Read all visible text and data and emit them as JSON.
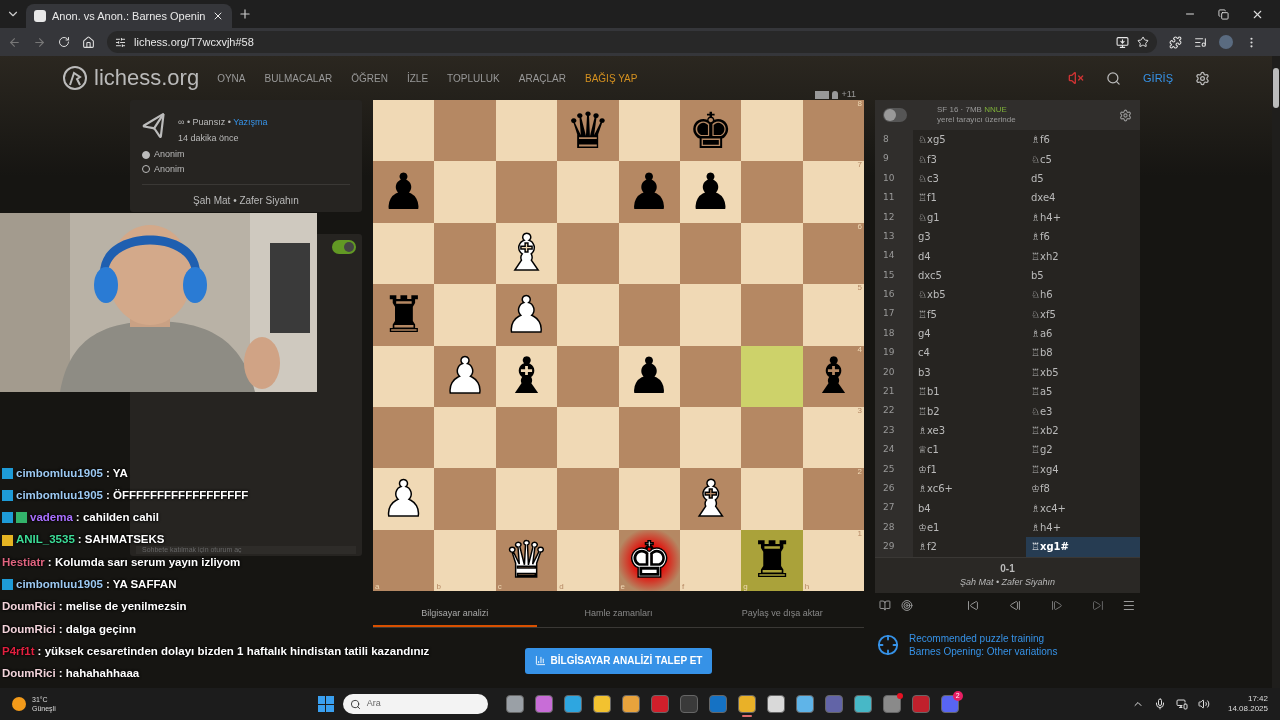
{
  "browser": {
    "tab_title": "Anon. vs Anon.: Barnes Openin",
    "url": "lichess.org/T7wcxvjh#58"
  },
  "site": {
    "logo": "lichess.org",
    "nav": [
      {
        "label": "OYNA",
        "kind": "plain"
      },
      {
        "label": "BULMACALAR",
        "kind": "plain"
      },
      {
        "label": "ÖĞREN",
        "kind": "plain"
      },
      {
        "label": "İZLE",
        "kind": "plain"
      },
      {
        "label": "TOPLULUK",
        "kind": "plain"
      },
      {
        "label": "ARAÇLAR",
        "kind": "plain"
      },
      {
        "label": "BAĞIŞ YAP",
        "kind": "donate"
      }
    ],
    "muted": true,
    "login": "GİRİŞ"
  },
  "game_info": {
    "speed": "∞",
    "separator": "•",
    "rated": "Puansız",
    "type": "Yazışma",
    "time_ago": "14 dakika önce",
    "players": [
      {
        "name": "Anonim",
        "white": true
      },
      {
        "name": "Anonim",
        "white": false
      }
    ],
    "status": "Şah Mat • Zafer Siyahın"
  },
  "chat_panel": {
    "enabled": true,
    "placeholder": "Sohbete katılmak için oturum aç"
  },
  "material": {
    "diff": "+11"
  },
  "board": {
    "files": [
      "a",
      "b",
      "c",
      "d",
      "e",
      "f",
      "g",
      "h"
    ],
    "rows": [
      {
        "rank": "8",
        "cells": [
          {
            "highlight": false
          },
          {
            "highlight": false
          },
          {
            "highlight": false
          },
          {
            "highlight": false,
            "piece": {
              "glyph": "♛",
              "white": false,
              "in_check": false
            }
          },
          {
            "highlight": false
          },
          {
            "highlight": false,
            "piece": {
              "glyph": "♚",
              "white": false,
              "in_check": false
            }
          },
          {
            "highlight": false
          },
          {
            "highlight": false
          }
        ]
      },
      {
        "rank": "7",
        "cells": [
          {
            "highlight": false,
            "piece": {
              "glyph": "♟",
              "white": false,
              "in_check": false
            }
          },
          {
            "highlight": false
          },
          {
            "highlight": false
          },
          {
            "highlight": false
          },
          {
            "highlight": false,
            "piece": {
              "glyph": "♟",
              "white": false,
              "in_check": false
            }
          },
          {
            "highlight": false,
            "piece": {
              "glyph": "♟",
              "white": false,
              "in_check": false
            }
          },
          {
            "highlight": false
          },
          {
            "highlight": false
          }
        ]
      },
      {
        "rank": "6",
        "cells": [
          {
            "highlight": false
          },
          {
            "highlight": false
          },
          {
            "highlight": false,
            "piece": {
              "glyph": "♝",
              "white": true,
              "in_check": false
            }
          },
          {
            "highlight": false
          },
          {
            "highlight": false
          },
          {
            "highlight": false
          },
          {
            "highlight": false
          },
          {
            "highlight": false
          }
        ]
      },
      {
        "rank": "5",
        "cells": [
          {
            "highlight": false,
            "piece": {
              "glyph": "♜",
              "white": false,
              "in_check": false
            }
          },
          {
            "highlight": false
          },
          {
            "highlight": false,
            "piece": {
              "glyph": "♟",
              "white": true,
              "in_check": false
            }
          },
          {
            "highlight": false
          },
          {
            "highlight": false
          },
          {
            "highlight": false
          },
          {
            "highlight": false
          },
          {
            "highlight": false
          }
        ]
      },
      {
        "rank": "4",
        "cells": [
          {
            "highlight": false
          },
          {
            "highlight": false,
            "piece": {
              "glyph": "♟",
              "white": true,
              "in_check": false
            }
          },
          {
            "highlight": false,
            "piece": {
              "glyph": "♝",
              "white": false,
              "in_check": false
            }
          },
          {
            "highlight": false
          },
          {
            "highlight": false,
            "piece": {
              "glyph": "♟",
              "white": false,
              "in_check": false
            }
          },
          {
            "highlight": false
          },
          {
            "highlight": true
          },
          {
            "highlight": false,
            "piece": {
              "glyph": "♝",
              "white": false,
              "in_check": false
            }
          }
        ]
      },
      {
        "rank": "3",
        "cells": [
          {
            "highlight": false
          },
          {
            "highlight": false
          },
          {
            "highlight": false
          },
          {
            "highlight": false
          },
          {
            "highlight": false
          },
          {
            "highlight": false
          },
          {
            "highlight": false
          },
          {
            "highlight": false
          }
        ]
      },
      {
        "rank": "2",
        "cells": [
          {
            "highlight": false,
            "piece": {
              "glyph": "♟",
              "white": true,
              "in_check": false
            }
          },
          {
            "highlight": false
          },
          {
            "highlight": false
          },
          {
            "highlight": false
          },
          {
            "highlight": false
          },
          {
            "highlight": false,
            "piece": {
              "glyph": "♝",
              "white": true,
              "in_check": false
            }
          },
          {
            "highlight": false
          },
          {
            "highlight": false
          }
        ]
      },
      {
        "rank": "1",
        "cells": [
          {
            "highlight": false
          },
          {
            "highlight": false
          },
          {
            "highlight": false,
            "piece": {
              "glyph": "♛",
              "white": true,
              "in_check": false
            }
          },
          {
            "highlight": false
          },
          {
            "highlight": false,
            "piece": {
              "glyph": "♚",
              "white": true,
              "in_check": true
            }
          },
          {
            "highlight": false
          },
          {
            "highlight": true,
            "piece": {
              "glyph": "♜",
              "white": false,
              "in_check": false
            }
          },
          {
            "highlight": false
          }
        ]
      }
    ]
  },
  "analysis_tabs": [
    {
      "label": "Bilgisayar analizi",
      "selected": true
    },
    {
      "label": "Hamle zamanları",
      "selected": false
    },
    {
      "label": "Paylaş ve dışa aktar",
      "selected": false
    }
  ],
  "analysis_button": "BİLGİSAYAR ANALİZİ TALEP ET",
  "engine": {
    "on": false,
    "name": "SF 16 · 7MB",
    "nnue": "NNUE",
    "location": "yerel tarayıcı üzerinde"
  },
  "moves": [
    {
      "n": "8",
      "white": "♘xg5",
      "black": "♗f6",
      "selected": false
    },
    {
      "n": "9",
      "white": "♘f3",
      "black": "♘c5",
      "selected": false
    },
    {
      "n": "10",
      "white": "♘c3",
      "black": "d5",
      "selected": false
    },
    {
      "n": "11",
      "white": "♖f1",
      "black": "dxe4",
      "selected": false
    },
    {
      "n": "12",
      "white": "♘g1",
      "black": "♗h4+",
      "selected": false
    },
    {
      "n": "13",
      "white": "g3",
      "black": "♗f6",
      "selected": false
    },
    {
      "n": "14",
      "white": "d4",
      "black": "♖xh2",
      "selected": false
    },
    {
      "n": "15",
      "white": "dxc5",
      "black": "b5",
      "selected": false
    },
    {
      "n": "16",
      "white": "♘xb5",
      "black": "♘h6",
      "selected": false
    },
    {
      "n": "17",
      "white": "♖f5",
      "black": "♘xf5",
      "selected": false
    },
    {
      "n": "18",
      "white": "g4",
      "black": "♗a6",
      "selected": false
    },
    {
      "n": "19",
      "white": "c4",
      "black": "♖b8",
      "selected": false
    },
    {
      "n": "20",
      "white": "b3",
      "black": "♖xb5",
      "selected": false
    },
    {
      "n": "21",
      "white": "♖b1",
      "black": "♖a5",
      "selected": false
    },
    {
      "n": "22",
      "white": "♖b2",
      "black": "♘e3",
      "selected": false
    },
    {
      "n": "23",
      "white": "♗xe3",
      "black": "♖xb2",
      "selected": false
    },
    {
      "n": "24",
      "white": "♕c1",
      "black": "♖g2",
      "selected": false
    },
    {
      "n": "25",
      "white": "♔f1",
      "black": "♖xg4",
      "selected": false
    },
    {
      "n": "26",
      "white": "♗xc6+",
      "black": "♔f8",
      "selected": false
    },
    {
      "n": "27",
      "white": "b4",
      "black": "♗xc4+",
      "selected": false
    },
    {
      "n": "28",
      "white": "♔e1",
      "black": "♗h4+",
      "selected": false
    },
    {
      "n": "29",
      "white": "♗f2",
      "black": "♖xg1#",
      "selected": true
    }
  ],
  "result": {
    "score": "0-1",
    "text": "Şah Mat • Zafer Siyahın"
  },
  "puzzle": {
    "title": "Recommended puzzle training",
    "opening": "Barnes Opening: Other variations"
  },
  "chat": {
    "separator": ":",
    "messages": [
      {
        "badges": [
          {
            "kind": "moderator"
          }
        ],
        "user": "cimbomluu1905",
        "color": "#9cc9f2",
        "text": "YA"
      },
      {
        "badges": [
          {
            "kind": "moderator"
          }
        ],
        "user": "cimbomluu1905",
        "color": "#9cc9f2",
        "text": "ÖFFFFFFFFFFFFFFFFFF"
      },
      {
        "badges": [
          {
            "kind": "moderator"
          },
          {
            "kind": "subscriber"
          }
        ],
        "user": "vadema",
        "color": "#a970ff",
        "text": "cahilden cahil"
      },
      {
        "badges": [
          {
            "kind": "crown"
          }
        ],
        "user": "ANIL_3535",
        "color": "#3ddc97",
        "text": "SAHMATSEKS"
      },
      {
        "user": "Hestiatr",
        "color": "#e0647f",
        "text": "Kolumda sarı serum yayın izliyom"
      },
      {
        "badges": [
          {
            "kind": "moderator"
          }
        ],
        "user": "cimbomluu1905",
        "color": "#9cc9f2",
        "text": "YA SAFFAN"
      },
      {
        "user": "DoumRici",
        "color": "#f2d3da",
        "text": "melise de yenilmezsin"
      },
      {
        "user": "DoumRici",
        "color": "#f2d3da",
        "text": "dalga geçinn"
      },
      {
        "user": "P4rf1t",
        "color": "#e0203f",
        "text": "yüksek cesaretinden dolayı bizden 1 haftalık hindistan tatili kazandınız"
      },
      {
        "user": "DoumRici",
        "color": "#f2d3da",
        "text": "hahahahhaaa"
      }
    ]
  },
  "taskbar": {
    "weather": {
      "temp": "31°C",
      "condition": "Güneşli"
    },
    "search": "Ara",
    "apps": [
      {
        "color": "#9aa0a6",
        "active": false,
        "alert": false
      },
      {
        "color": "#c86dd7",
        "active": false,
        "alert": false
      },
      {
        "color": "#2ea6e0",
        "active": false,
        "alert": false
      },
      {
        "color": "#f2c230",
        "active": false,
        "alert": false
      },
      {
        "color": "#e8a33c",
        "active": false,
        "alert": false
      },
      {
        "color": "#d21f2b",
        "active": false,
        "alert": false
      },
      {
        "color": "#3a3a3a",
        "active": false,
        "alert": false
      },
      {
        "color": "#1572c4",
        "active": false,
        "alert": false
      },
      {
        "color": "#e9b128",
        "active": true,
        "alert": false
      },
      {
        "color": "#d9d9d9",
        "active": false,
        "alert": false
      },
      {
        "color": "#5fb4e8",
        "active": false,
        "alert": false
      },
      {
        "color": "#6264a7",
        "active": false,
        "alert": false
      },
      {
        "color": "#47b8c7",
        "active": false,
        "alert": false
      },
      {
        "color": "#8a8a8a",
        "active": false,
        "alert": true
      },
      {
        "color": "#c0202c",
        "active": false,
        "alert": false
      },
      {
        "color": "#5865f2",
        "active": false,
        "alert": false,
        "badge": "2"
      }
    ],
    "time": "17:42",
    "date": "14.08.2025"
  }
}
